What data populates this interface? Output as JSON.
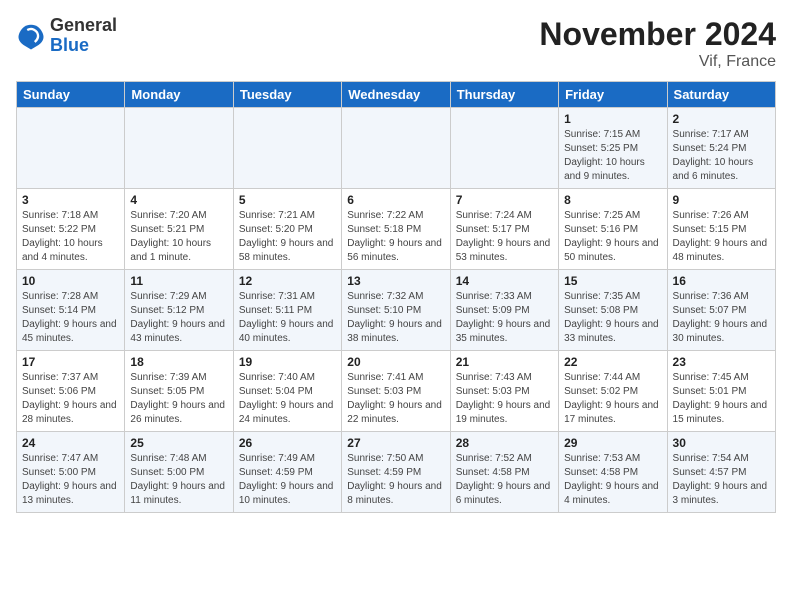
{
  "logo": {
    "general": "General",
    "blue": "Blue"
  },
  "title": "November 2024",
  "subtitle": "Vif, France",
  "days_of_week": [
    "Sunday",
    "Monday",
    "Tuesday",
    "Wednesday",
    "Thursday",
    "Friday",
    "Saturday"
  ],
  "weeks": [
    [
      {
        "day": "",
        "info": ""
      },
      {
        "day": "",
        "info": ""
      },
      {
        "day": "",
        "info": ""
      },
      {
        "day": "",
        "info": ""
      },
      {
        "day": "",
        "info": ""
      },
      {
        "day": "1",
        "info": "Sunrise: 7:15 AM\nSunset: 5:25 PM\nDaylight: 10 hours and 9 minutes."
      },
      {
        "day": "2",
        "info": "Sunrise: 7:17 AM\nSunset: 5:24 PM\nDaylight: 10 hours and 6 minutes."
      }
    ],
    [
      {
        "day": "3",
        "info": "Sunrise: 7:18 AM\nSunset: 5:22 PM\nDaylight: 10 hours and 4 minutes."
      },
      {
        "day": "4",
        "info": "Sunrise: 7:20 AM\nSunset: 5:21 PM\nDaylight: 10 hours and 1 minute."
      },
      {
        "day": "5",
        "info": "Sunrise: 7:21 AM\nSunset: 5:20 PM\nDaylight: 9 hours and 58 minutes."
      },
      {
        "day": "6",
        "info": "Sunrise: 7:22 AM\nSunset: 5:18 PM\nDaylight: 9 hours and 56 minutes."
      },
      {
        "day": "7",
        "info": "Sunrise: 7:24 AM\nSunset: 5:17 PM\nDaylight: 9 hours and 53 minutes."
      },
      {
        "day": "8",
        "info": "Sunrise: 7:25 AM\nSunset: 5:16 PM\nDaylight: 9 hours and 50 minutes."
      },
      {
        "day": "9",
        "info": "Sunrise: 7:26 AM\nSunset: 5:15 PM\nDaylight: 9 hours and 48 minutes."
      }
    ],
    [
      {
        "day": "10",
        "info": "Sunrise: 7:28 AM\nSunset: 5:14 PM\nDaylight: 9 hours and 45 minutes."
      },
      {
        "day": "11",
        "info": "Sunrise: 7:29 AM\nSunset: 5:12 PM\nDaylight: 9 hours and 43 minutes."
      },
      {
        "day": "12",
        "info": "Sunrise: 7:31 AM\nSunset: 5:11 PM\nDaylight: 9 hours and 40 minutes."
      },
      {
        "day": "13",
        "info": "Sunrise: 7:32 AM\nSunset: 5:10 PM\nDaylight: 9 hours and 38 minutes."
      },
      {
        "day": "14",
        "info": "Sunrise: 7:33 AM\nSunset: 5:09 PM\nDaylight: 9 hours and 35 minutes."
      },
      {
        "day": "15",
        "info": "Sunrise: 7:35 AM\nSunset: 5:08 PM\nDaylight: 9 hours and 33 minutes."
      },
      {
        "day": "16",
        "info": "Sunrise: 7:36 AM\nSunset: 5:07 PM\nDaylight: 9 hours and 30 minutes."
      }
    ],
    [
      {
        "day": "17",
        "info": "Sunrise: 7:37 AM\nSunset: 5:06 PM\nDaylight: 9 hours and 28 minutes."
      },
      {
        "day": "18",
        "info": "Sunrise: 7:39 AM\nSunset: 5:05 PM\nDaylight: 9 hours and 26 minutes."
      },
      {
        "day": "19",
        "info": "Sunrise: 7:40 AM\nSunset: 5:04 PM\nDaylight: 9 hours and 24 minutes."
      },
      {
        "day": "20",
        "info": "Sunrise: 7:41 AM\nSunset: 5:03 PM\nDaylight: 9 hours and 22 minutes."
      },
      {
        "day": "21",
        "info": "Sunrise: 7:43 AM\nSunset: 5:03 PM\nDaylight: 9 hours and 19 minutes."
      },
      {
        "day": "22",
        "info": "Sunrise: 7:44 AM\nSunset: 5:02 PM\nDaylight: 9 hours and 17 minutes."
      },
      {
        "day": "23",
        "info": "Sunrise: 7:45 AM\nSunset: 5:01 PM\nDaylight: 9 hours and 15 minutes."
      }
    ],
    [
      {
        "day": "24",
        "info": "Sunrise: 7:47 AM\nSunset: 5:00 PM\nDaylight: 9 hours and 13 minutes."
      },
      {
        "day": "25",
        "info": "Sunrise: 7:48 AM\nSunset: 5:00 PM\nDaylight: 9 hours and 11 minutes."
      },
      {
        "day": "26",
        "info": "Sunrise: 7:49 AM\nSunset: 4:59 PM\nDaylight: 9 hours and 10 minutes."
      },
      {
        "day": "27",
        "info": "Sunrise: 7:50 AM\nSunset: 4:59 PM\nDaylight: 9 hours and 8 minutes."
      },
      {
        "day": "28",
        "info": "Sunrise: 7:52 AM\nSunset: 4:58 PM\nDaylight: 9 hours and 6 minutes."
      },
      {
        "day": "29",
        "info": "Sunrise: 7:53 AM\nSunset: 4:58 PM\nDaylight: 9 hours and 4 minutes."
      },
      {
        "day": "30",
        "info": "Sunrise: 7:54 AM\nSunset: 4:57 PM\nDaylight: 9 hours and 3 minutes."
      }
    ]
  ]
}
